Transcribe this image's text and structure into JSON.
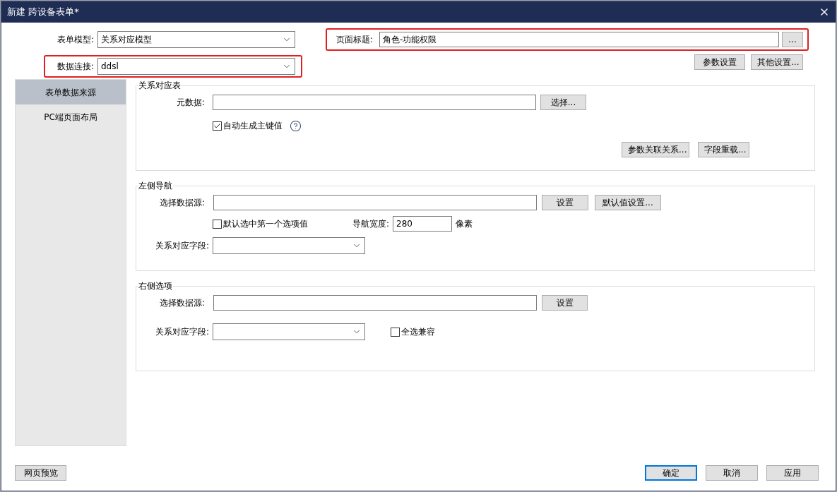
{
  "window": {
    "title": "新建 跨设备表单*"
  },
  "form_model": {
    "label": "表单模型:",
    "value": "关系对应模型"
  },
  "data_connection": {
    "label": "数据连接:",
    "value": "ddsl",
    "highlighted": true
  },
  "page_title": {
    "label": "页面标题:",
    "value": "角色-功能权限",
    "button": "...",
    "highlighted": true
  },
  "top_buttons": [
    "参数设置",
    "其他设置..."
  ],
  "sidebar": {
    "items": [
      {
        "label": "表单数据来源",
        "selected": true
      },
      {
        "label": "PC端页面布局",
        "selected": false
      }
    ]
  },
  "relation_table": {
    "title": "关系对应表",
    "metadata_label": "元数据:",
    "select_button": "选择...",
    "auto_key": {
      "label": "自动生成主键值",
      "checked": true
    },
    "buttons": [
      "参数关联关系...",
      "字段重载..."
    ]
  },
  "left_nav": {
    "title": "左侧导航",
    "source_label": "选择数据源:",
    "set_button": "设置",
    "default_button": "默认值设置...",
    "first_option": {
      "label": "默认选中第一个选项值",
      "checked": false
    },
    "width_label": "导航宽度:",
    "width_value": "280",
    "width_unit": "像素",
    "field_label": "关系对应字段:"
  },
  "right_options": {
    "title": "右侧选项",
    "source_label": "选择数据源:",
    "set_button": "设置",
    "field_label": "关系对应字段:",
    "select_all": {
      "label": "全选兼容",
      "checked": false
    }
  },
  "footer": {
    "preview_button": "网页预览",
    "buttons": [
      {
        "label": "确定",
        "focused": true
      },
      {
        "label": "取消",
        "focused": false
      },
      {
        "label": "应用",
        "focused": false
      }
    ]
  }
}
